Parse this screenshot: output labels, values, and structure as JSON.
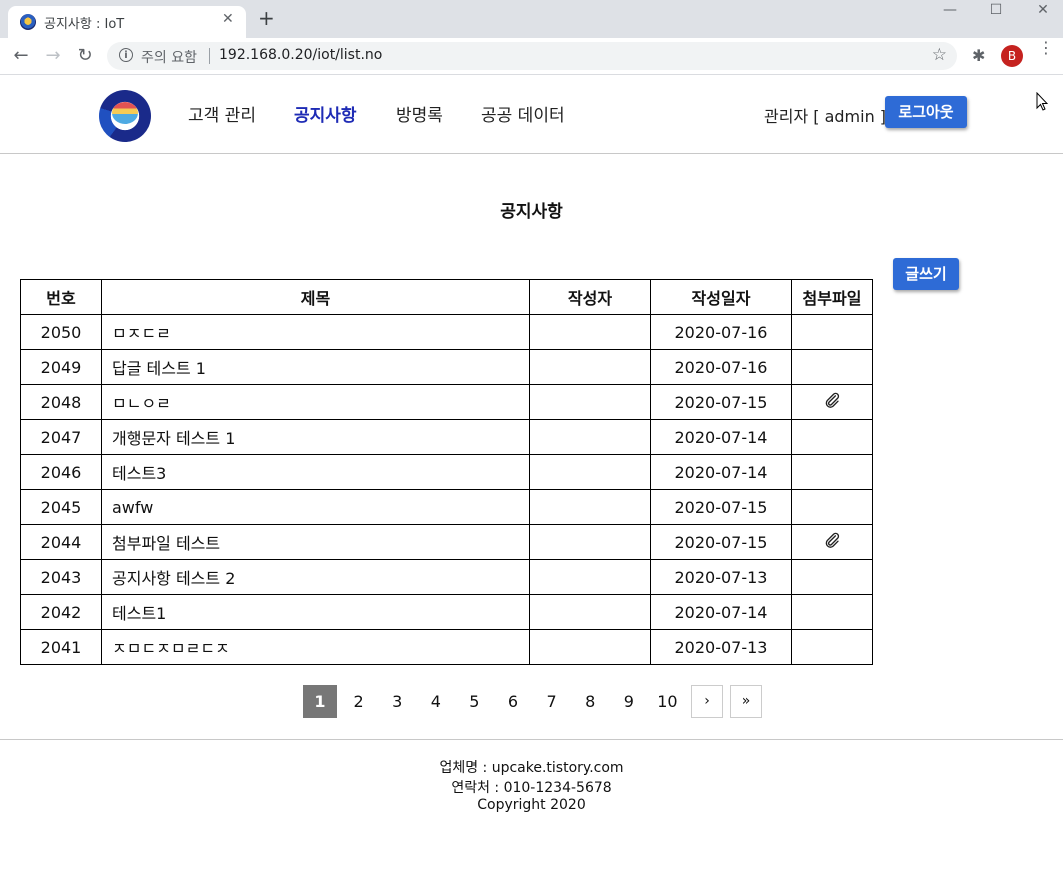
{
  "browser": {
    "tab_title": "공지사항 : IoT",
    "security_text": "주의 요함",
    "url": "192.168.0.20/iot/list.no",
    "profile_initial": "B"
  },
  "header": {
    "nav": [
      "고객 관리",
      "공지사항",
      "방명록",
      "공공 데이터"
    ],
    "active_nav": "공지사항",
    "admin_label": "관리자 [ admin ]",
    "logout_label": "로그아웃"
  },
  "main": {
    "title": "공지사항",
    "write_label": "글쓰기",
    "columns": [
      "번호",
      "제목",
      "작성자",
      "작성일자",
      "첨부파일"
    ],
    "rows": [
      {
        "no": "2050",
        "title": "ㅁㅈㄷㄹ",
        "writer": "",
        "date": "2020-07-16",
        "attachment": false
      },
      {
        "no": "2049",
        "title": "답글 테스트 1",
        "writer": "",
        "date": "2020-07-16",
        "attachment": false
      },
      {
        "no": "2048",
        "title": "ㅁㄴㅇㄹ",
        "writer": "",
        "date": "2020-07-15",
        "attachment": true
      },
      {
        "no": "2047",
        "title": "개행문자 테스트 1",
        "writer": "",
        "date": "2020-07-14",
        "attachment": false
      },
      {
        "no": "2046",
        "title": "테스트3",
        "writer": "",
        "date": "2020-07-14",
        "attachment": false
      },
      {
        "no": "2045",
        "title": "awfw",
        "writer": "",
        "date": "2020-07-15",
        "attachment": false
      },
      {
        "no": "2044",
        "title": "첨부파일 테스트",
        "writer": "",
        "date": "2020-07-15",
        "attachment": true
      },
      {
        "no": "2043",
        "title": "공지사항 테스트 2",
        "writer": "",
        "date": "2020-07-13",
        "attachment": false
      },
      {
        "no": "2042",
        "title": "테스트1",
        "writer": "",
        "date": "2020-07-14",
        "attachment": false
      },
      {
        "no": "2041",
        "title": "ㅈㅁㄷㅈㅁㄹㄷㅈ",
        "writer": "",
        "date": "2020-07-13",
        "attachment": false
      }
    ]
  },
  "pagination": {
    "pages": [
      "1",
      "2",
      "3",
      "4",
      "5",
      "6",
      "7",
      "8",
      "9",
      "10"
    ],
    "current": "1",
    "next_label": "›",
    "last_label": "»"
  },
  "footer": {
    "company": "업체명 : upcake.tistory.com",
    "contact": "연락처 : 010-1234-5678",
    "copyright": "Copyright 2020"
  },
  "colors": {
    "accent": "#2e6bd6",
    "active_nav": "#1e2bb5",
    "current_page": "#777777"
  }
}
